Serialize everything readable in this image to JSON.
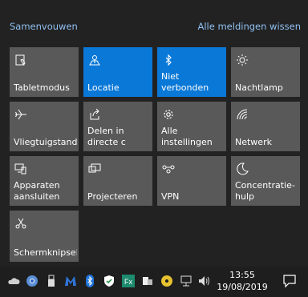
{
  "header": {
    "collapse_label": "Samenvouwen",
    "clear_all_label": "Alle meldingen wissen"
  },
  "tiles": [
    {
      "label": "Tabletmodus",
      "icon": "tablet-mode-icon",
      "active": false
    },
    {
      "label": "Locatie",
      "icon": "location-icon",
      "active": true
    },
    {
      "label": "Niet verbonden",
      "icon": "bluetooth-icon",
      "active": true
    },
    {
      "label": "Nachtlamp",
      "icon": "night-light-icon",
      "active": false
    },
    {
      "label": "Vliegtuigstand",
      "icon": "airplane-icon",
      "active": false
    },
    {
      "label": "Delen in\ndirecte c",
      "icon": "share-icon",
      "active": false
    },
    {
      "label": "Alle\ninstellingen",
      "icon": "gear-icon",
      "active": false
    },
    {
      "label": "Netwerk",
      "icon": "network-icon",
      "active": false
    },
    {
      "label": "Apparaten\naansluiten",
      "icon": "connect-devices-icon",
      "active": false
    },
    {
      "label": "Projecteren",
      "icon": "project-icon",
      "active": false
    },
    {
      "label": "VPN",
      "icon": "vpn-icon",
      "active": false
    },
    {
      "label": "Concentratie-\nhulp",
      "icon": "focus-assist-icon",
      "active": false
    },
    {
      "label": "Schermknipsel",
      "icon": "screen-snip-icon",
      "active": false
    }
  ],
  "taskbar": {
    "tray_icons": [
      "onedrive-icon",
      "chrome-icon",
      "usb-icon",
      "malwarebytes-icon",
      "bluetooth-tray-icon",
      "security-icon",
      "foxit-icon",
      "app-icon",
      "dvd-icon",
      "network-tray-icon",
      "volume-icon"
    ],
    "time": "13:55",
    "date": "19/08/2019",
    "notification_icon": "action-center-icon"
  },
  "colors": {
    "accent": "#0a78d7",
    "tile": "#595959",
    "panel": "#222222",
    "link": "#8fc0f2"
  }
}
